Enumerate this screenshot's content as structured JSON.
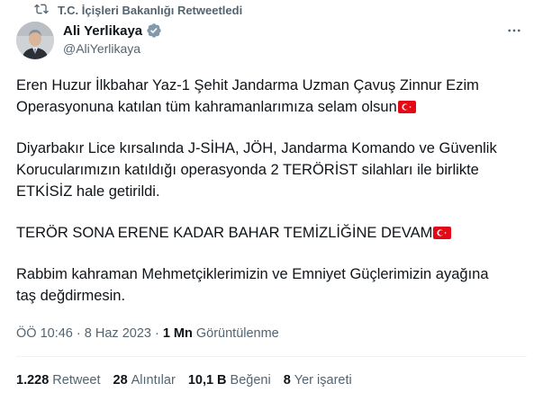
{
  "retweet": {
    "label": "T.C. İçişleri Bakanlığı Retweetledi"
  },
  "author": {
    "name": "Ali Yerlikaya",
    "handle": "@AliYerlikaya"
  },
  "tweet": {
    "paragraphs": [
      "Eren Huzur İlkbahar Yaz-1 Şehit Jandarma Uzman Çavuş Zinnur Ezim\nOperasyonuna katılan tüm kahramanlarımıza selam olsun",
      "Diyarbakır Lice kırsalında J-SİHA, JÖH, Jandarma Komando ve Güvenlik\nKorucularımızın katıldığı operasyonda 2 TERÖRİST silahları ile birlikte\nETKİSİZ hale getirildi.",
      "TERÖR SONA ERENE KADAR BAHAR TEMİZLİĞİNE DEVAM",
      "Rabbim kahraman Mehmetçiklerimizin ve Emniyet Güçlerimizin ayağına\ntaş değdirmesin."
    ]
  },
  "meta": {
    "time": "ÖÖ 10:46",
    "separator": "·",
    "date": "8 Haz 2023",
    "views_count": "1 Mn",
    "views_label": "Görüntülenme"
  },
  "stats": {
    "retweets_count": "1.228",
    "retweets_label": "Retweet",
    "quotes_count": "28",
    "quotes_label": "Alıntılar",
    "likes_count": "10,1 B",
    "likes_label": "Beğeni",
    "bookmarks_count": "8",
    "bookmarks_label": "Yer işareti"
  },
  "colors": {
    "text_primary": "#0f1419",
    "text_secondary": "#536471",
    "verified_badge": "#829aab",
    "flag_red": "#e30a17",
    "divider": "#eff3f4"
  },
  "icons": {
    "retweet": "retweet-icon",
    "verified": "verified-badge-icon",
    "more": "more-options-icon",
    "flag": "turkish-flag-emoji"
  }
}
